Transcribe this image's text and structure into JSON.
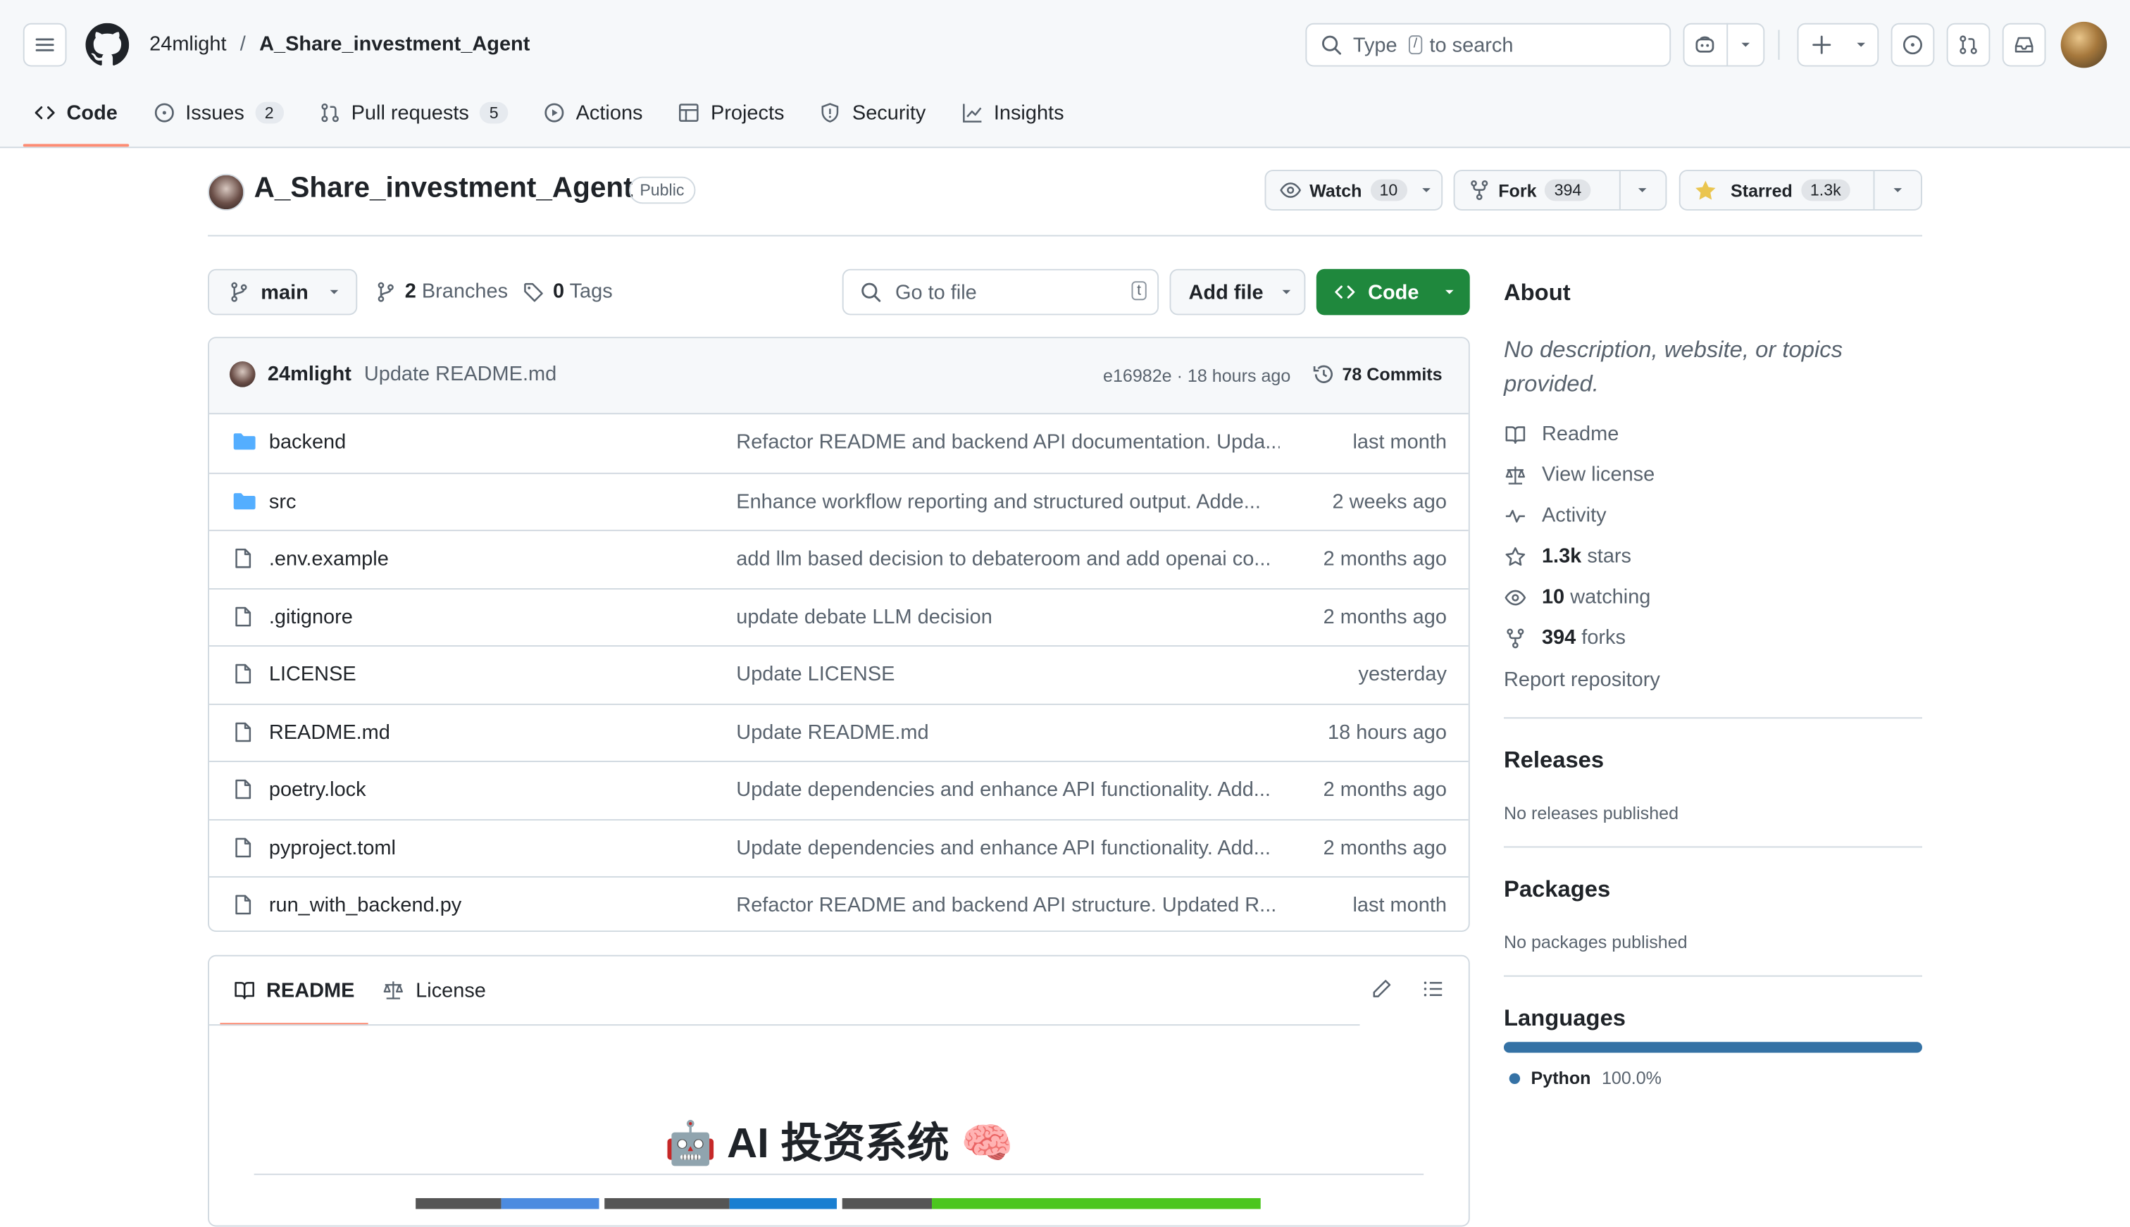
{
  "header": {
    "owner": "24mlight",
    "separator": "/",
    "repo": "A_Share_investment_Agent",
    "search_pre": "Type",
    "search_key": "/",
    "search_post": "to search"
  },
  "tabs": [
    {
      "label": "Code"
    },
    {
      "label": "Issues",
      "count": "2"
    },
    {
      "label": "Pull requests",
      "count": "5"
    },
    {
      "label": "Actions"
    },
    {
      "label": "Projects"
    },
    {
      "label": "Security"
    },
    {
      "label": "Insights"
    }
  ],
  "repo_head": {
    "title": "A_Share_investment_Agent",
    "visibility": "Public",
    "watch_label": "Watch",
    "watch_count": "10",
    "fork_label": "Fork",
    "fork_count": "394",
    "star_label": "Starred",
    "star_count": "1.3k"
  },
  "toolbar": {
    "branch": "main",
    "branches_count": "2",
    "branches_label": "Branches",
    "tags_count": "0",
    "tags_label": "Tags",
    "goto_placeholder": "Go to file",
    "goto_key": "t",
    "add_file": "Add file",
    "code": "Code"
  },
  "commit": {
    "author": "24mlight",
    "message": "Update README.md",
    "hash_time": "e16982e · 18 hours ago",
    "commits": "78 Commits"
  },
  "files": [
    {
      "type": "dir",
      "name": "backend",
      "message": "Refactor README and backend API documentation. Upda...",
      "date": "last month"
    },
    {
      "type": "dir",
      "name": "src",
      "message": "Enhance workflow reporting and structured output. Adde...",
      "date": "2 weeks ago"
    },
    {
      "type": "file",
      "name": ".env.example",
      "message": "add llm based decision to debateroom and add openai co...",
      "date": "2 months ago"
    },
    {
      "type": "file",
      "name": ".gitignore",
      "message": "update debate LLM decision",
      "date": "2 months ago"
    },
    {
      "type": "file",
      "name": "LICENSE",
      "message": "Update LICENSE",
      "date": "yesterday"
    },
    {
      "type": "file",
      "name": "README.md",
      "message": "Update README.md",
      "date": "18 hours ago"
    },
    {
      "type": "file",
      "name": "poetry.lock",
      "message": "Update dependencies and enhance API functionality. Add...",
      "date": "2 months ago"
    },
    {
      "type": "file",
      "name": "pyproject.toml",
      "message": "Update dependencies and enhance API functionality. Add...",
      "date": "2 months ago"
    },
    {
      "type": "file",
      "name": "run_with_backend.py",
      "message": "Refactor README and backend API structure. Updated R...",
      "date": "last month"
    }
  ],
  "readme": {
    "tab_readme": "README",
    "tab_license": "License",
    "heading": "🤖 AI 投资系统 🧠"
  },
  "about": {
    "title": "About",
    "description": "No description, website, or topics provided.",
    "readme": "Readme",
    "license": "View license",
    "activity": "Activity",
    "stars_count": "1.3k",
    "stars_label": "stars",
    "watching_count": "10",
    "watching_label": "watching",
    "forks_count": "394",
    "forks_label": "forks",
    "report": "Report repository"
  },
  "releases": {
    "title": "Releases",
    "text": "No releases published"
  },
  "packages": {
    "title": "Packages",
    "text": "No packages published"
  },
  "languages": {
    "title": "Languages",
    "name": "Python",
    "percent": "100.0%",
    "color": "#3572a5"
  }
}
